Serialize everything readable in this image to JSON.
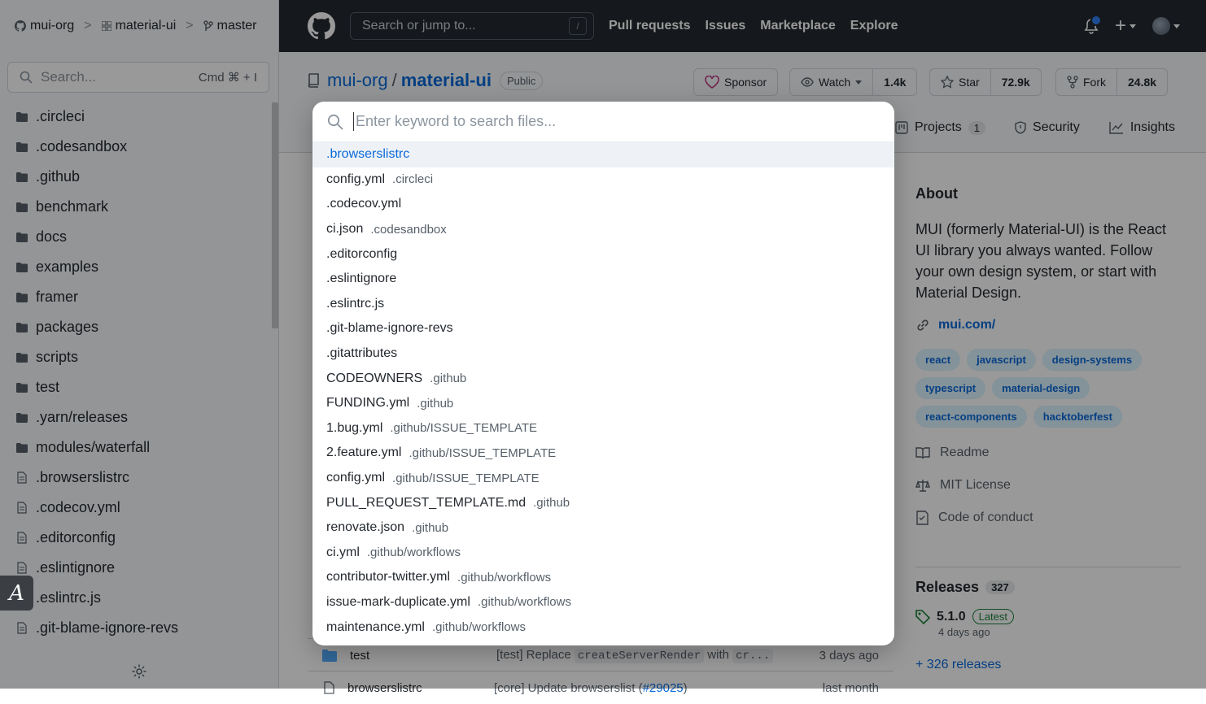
{
  "sidebar": {
    "breadcrumb": {
      "owner": "mui-org",
      "repo": "material-ui",
      "branch": "master"
    },
    "search": {
      "placeholder": "Search...",
      "shortcut": "Cmd ⌘ + I"
    },
    "items": [
      {
        "label": ".circleci",
        "type": "folder"
      },
      {
        "label": ".codesandbox",
        "type": "folder"
      },
      {
        "label": ".github",
        "type": "folder"
      },
      {
        "label": "benchmark",
        "type": "folder"
      },
      {
        "label": "docs",
        "type": "folder"
      },
      {
        "label": "examples",
        "type": "folder"
      },
      {
        "label": "framer",
        "type": "folder"
      },
      {
        "label": "packages",
        "type": "folder"
      },
      {
        "label": "scripts",
        "type": "folder"
      },
      {
        "label": "test",
        "type": "folder"
      },
      {
        "label": ".yarn/releases",
        "type": "folder"
      },
      {
        "label": "modules/waterfall",
        "type": "folder"
      },
      {
        "label": ".browserslistrc",
        "type": "file"
      },
      {
        "label": ".codecov.yml",
        "type": "file"
      },
      {
        "label": ".editorconfig",
        "type": "file"
      },
      {
        "label": ".eslintignore",
        "type": "file"
      },
      {
        "label": ".eslintrc.js",
        "type": "file"
      },
      {
        "label": ".git-blame-ignore-revs",
        "type": "file"
      }
    ],
    "a_button": "A"
  },
  "header": {
    "search_placeholder": "Search or jump to...",
    "search_key": "/",
    "nav": [
      "Pull requests",
      "Issues",
      "Marketplace",
      "Explore"
    ],
    "plus": "+"
  },
  "repo": {
    "owner": "mui-org",
    "name": "material-ui",
    "visibility": "Public",
    "sponsor": "Sponsor",
    "watch": "Watch",
    "watch_count": "1.4k",
    "star": "Star",
    "star_count": "72.9k",
    "fork": "Fork",
    "fork_count": "24.8k",
    "tabs": [
      {
        "label": "Projects",
        "count": "1"
      },
      {
        "label": "Security"
      },
      {
        "label": "Insights"
      }
    ]
  },
  "files": [
    {
      "name": "test",
      "message": "[test] Replace",
      "code1": "createServerRender",
      "mid": "with",
      "code2": "cr...",
      "age": "3 days ago"
    },
    {
      "name": "browserslistrc",
      "message": "[core] Update browserslist (",
      "link": "#29025",
      "message_end": ")",
      "age": "last month"
    }
  ],
  "about": {
    "title": "About",
    "description": "MUI (formerly Material-UI) is the React UI library you always wanted. Follow your own design system, or start with Material Design.",
    "website": "mui.com/",
    "topics": [
      "react",
      "javascript",
      "design-systems",
      "typescript",
      "material-design",
      "react-components",
      "hacktoberfest"
    ],
    "links": [
      "Readme",
      "MIT License",
      "Code of conduct"
    ]
  },
  "releases": {
    "title": "Releases",
    "count": "327",
    "latest_version": "5.1.0",
    "latest_label": "Latest",
    "latest_date": "4 days ago",
    "more": "+ 326 releases"
  },
  "modal": {
    "placeholder": "Enter keyword to search files...",
    "results": [
      {
        "name": ".browserslistrc",
        "path": ""
      },
      {
        "name": "config.yml",
        "path": ".circleci"
      },
      {
        "name": ".codecov.yml",
        "path": ""
      },
      {
        "name": "ci.json",
        "path": ".codesandbox"
      },
      {
        "name": ".editorconfig",
        "path": ""
      },
      {
        "name": ".eslintignore",
        "path": ""
      },
      {
        "name": ".eslintrc.js",
        "path": ""
      },
      {
        "name": ".git-blame-ignore-revs",
        "path": ""
      },
      {
        "name": ".gitattributes",
        "path": ""
      },
      {
        "name": "CODEOWNERS",
        "path": ".github"
      },
      {
        "name": "FUNDING.yml",
        "path": ".github"
      },
      {
        "name": "1.bug.yml",
        "path": ".github/ISSUE_TEMPLATE"
      },
      {
        "name": "2.feature.yml",
        "path": ".github/ISSUE_TEMPLATE"
      },
      {
        "name": "config.yml",
        "path": ".github/ISSUE_TEMPLATE"
      },
      {
        "name": "PULL_REQUEST_TEMPLATE.md",
        "path": ".github"
      },
      {
        "name": "renovate.json",
        "path": ".github"
      },
      {
        "name": "ci.yml",
        "path": ".github/workflows"
      },
      {
        "name": "contributor-twitter.yml",
        "path": ".github/workflows"
      },
      {
        "name": "issue-mark-duplicate.yml",
        "path": ".github/workflows"
      },
      {
        "name": "maintenance.yml",
        "path": ".github/workflows"
      }
    ]
  },
  "colors": {
    "accent": "#0969da",
    "header_bg": "#24292f",
    "sidebar_bg": "#f6f8fa",
    "selected_row": "#eef2f6"
  }
}
